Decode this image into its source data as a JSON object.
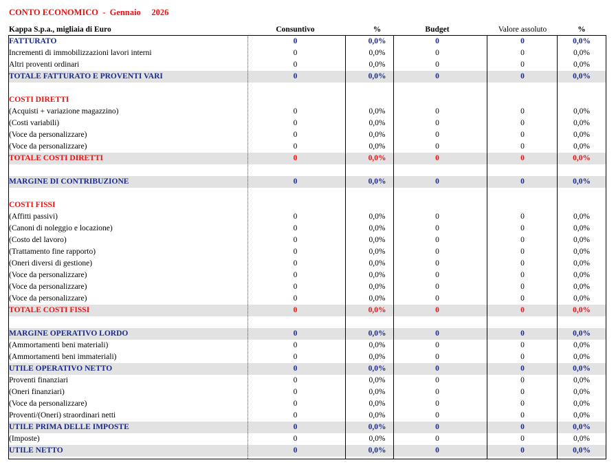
{
  "title": "CONTO ECONOMICO  -  Gennaio     2026",
  "header": {
    "company": "Kappa S.p.a., migliaia di Euro",
    "col1": "Consuntivo",
    "col2": "%",
    "col3": "Budget",
    "col4": "Valore assoluto",
    "col5": "%"
  },
  "rows": [
    {
      "label": "FATTURATO",
      "style": "head-blue",
      "v": [
        "0",
        "0,0%",
        "0",
        "0",
        "0,0%"
      ]
    },
    {
      "label": "Incrementi di immobilizzazioni lavori interni",
      "style": "normal",
      "v": [
        "0",
        "0,0%",
        "0",
        "0",
        "0,0%"
      ]
    },
    {
      "label": "Altri proventi ordinari",
      "style": "normal",
      "v": [
        "0",
        "0,0%",
        "0",
        "0",
        "0,0%"
      ]
    },
    {
      "label": "TOTALE FATTURATO E PROVENTI VARI",
      "style": "total-blue",
      "v": [
        "0",
        "0,0%",
        "0",
        "0",
        "0,0%"
      ]
    },
    {
      "label": "",
      "style": "blank",
      "v": [
        "",
        "",
        "",
        "",
        ""
      ]
    },
    {
      "label": "COSTI DIRETTI",
      "style": "head-red",
      "v": [
        "",
        "",
        "",
        "",
        ""
      ]
    },
    {
      "label": "(Acquisti + variazione magazzino)",
      "style": "normal",
      "v": [
        "0",
        "0,0%",
        "0",
        "0",
        "0,0%"
      ]
    },
    {
      "label": "(Costi variabili)",
      "style": "normal",
      "v": [
        "0",
        "0,0%",
        "0",
        "0",
        "0,0%"
      ]
    },
    {
      "label": "(Voce da personalizzare)",
      "style": "normal",
      "v": [
        "0",
        "0,0%",
        "0",
        "0",
        "0,0%"
      ]
    },
    {
      "label": "(Voce da personalizzare)",
      "style": "normal",
      "v": [
        "0",
        "0,0%",
        "0",
        "0",
        "0,0%"
      ]
    },
    {
      "label": "TOTALE COSTI DIRETTI",
      "style": "total-red",
      "v": [
        "0",
        "0,0%",
        "0",
        "0",
        "0,0%"
      ]
    },
    {
      "label": "",
      "style": "blank",
      "v": [
        "",
        "",
        "",
        "",
        ""
      ]
    },
    {
      "label": "MARGINE DI CONTRIBUZIONE",
      "style": "total-blue",
      "v": [
        "0",
        "0,0%",
        "0",
        "0",
        "0,0%"
      ]
    },
    {
      "label": "",
      "style": "blank",
      "v": [
        "",
        "",
        "",
        "",
        ""
      ]
    },
    {
      "label": "COSTI FISSI",
      "style": "head-red",
      "v": [
        "",
        "",
        "",
        "",
        ""
      ]
    },
    {
      "label": "(Affitti passivi)",
      "style": "normal",
      "v": [
        "0",
        "0,0%",
        "0",
        "0",
        "0,0%"
      ]
    },
    {
      "label": "(Canoni di noleggio e locazione)",
      "style": "normal",
      "v": [
        "0",
        "0,0%",
        "0",
        "0",
        "0,0%"
      ]
    },
    {
      "label": "(Costo del lavoro)",
      "style": "normal",
      "v": [
        "0",
        "0,0%",
        "0",
        "0",
        "0,0%"
      ]
    },
    {
      "label": "(Trattamento fine rapporto)",
      "style": "normal",
      "v": [
        "0",
        "0,0%",
        "0",
        "0",
        "0,0%"
      ]
    },
    {
      "label": "(Oneri diversi di gestione)",
      "style": "normal",
      "v": [
        "0",
        "0,0%",
        "0",
        "0",
        "0,0%"
      ]
    },
    {
      "label": "(Voce da personalizzare)",
      "style": "normal",
      "v": [
        "0",
        "0,0%",
        "0",
        "0",
        "0,0%"
      ]
    },
    {
      "label": "(Voce da personalizzare)",
      "style": "normal",
      "v": [
        "0",
        "0,0%",
        "0",
        "0",
        "0,0%"
      ]
    },
    {
      "label": "(Voce da personalizzare)",
      "style": "normal",
      "v": [
        "0",
        "0,0%",
        "0",
        "0",
        "0,0%"
      ]
    },
    {
      "label": "TOTALE COSTI FISSI",
      "style": "total-red",
      "v": [
        "0",
        "0,0%",
        "0",
        "0",
        "0,0%"
      ]
    },
    {
      "label": "",
      "style": "blank",
      "v": [
        "",
        "",
        "",
        "",
        ""
      ]
    },
    {
      "label": "MARGINE OPERATIVO LORDO",
      "style": "total-blue",
      "v": [
        "0",
        "0,0%",
        "0",
        "0",
        "0,0%"
      ]
    },
    {
      "label": "(Ammortamenti beni materiali)",
      "style": "normal",
      "v": [
        "0",
        "0,0%",
        "0",
        "0",
        "0,0%"
      ]
    },
    {
      "label": "(Ammortamenti beni immateriali)",
      "style": "normal",
      "v": [
        "0",
        "0,0%",
        "0",
        "0",
        "0,0%"
      ]
    },
    {
      "label": "UTILE OPERATIVO NETTO",
      "style": "total-blue",
      "v": [
        "0",
        "0,0%",
        "0",
        "0",
        "0,0%"
      ]
    },
    {
      "label": "Proventi finanziari",
      "style": "normal",
      "v": [
        "0",
        "0,0%",
        "0",
        "0",
        "0,0%"
      ]
    },
    {
      "label": "(Oneri finanziari)",
      "style": "normal",
      "v": [
        "0",
        "0,0%",
        "0",
        "0",
        "0,0%"
      ]
    },
    {
      "label": "(Voce da personalizzare)",
      "style": "normal",
      "v": [
        "0",
        "0,0%",
        "0",
        "0",
        "0,0%"
      ]
    },
    {
      "label": "Proventi/(Oneri) straordinari netti",
      "style": "normal",
      "v": [
        "0",
        "0,0%",
        "0",
        "0",
        "0,0%"
      ]
    },
    {
      "label": "UTILE PRIMA DELLE IMPOSTE",
      "style": "total-blue",
      "v": [
        "0",
        "0,0%",
        "0",
        "0",
        "0,0%"
      ]
    },
    {
      "label": "(Imposte)",
      "style": "normal",
      "v": [
        "0",
        "0,0%",
        "0",
        "0",
        "0,0%"
      ]
    },
    {
      "label": "UTILE NETTO",
      "style": "total-blue",
      "v": [
        "0",
        "0,0%",
        "0",
        "0",
        "0,0%"
      ]
    }
  ]
}
